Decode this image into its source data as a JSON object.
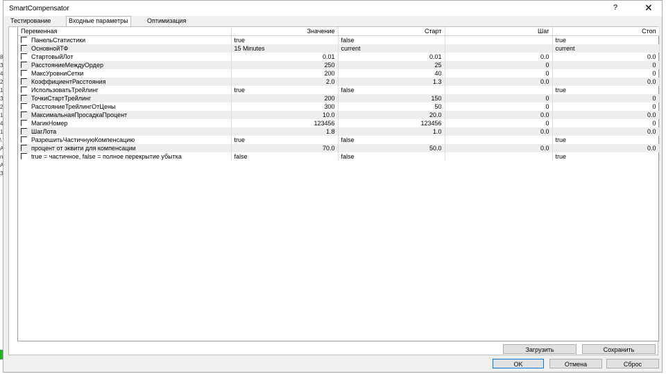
{
  "window": {
    "title": "SmartCompensator",
    "help_label": "?",
    "close_label": "✕"
  },
  "background_glyphs": [
    "8",
    "3",
    "4",
    "2",
    "1",
    "3",
    "2",
    "1",
    "4",
    "1",
    "\\",
    "A",
    "n",
    "A",
    "3"
  ],
  "tabs": [
    "Тестирование",
    "Входные параметры",
    "Оптимизация"
  ],
  "active_tab": 1,
  "columns": [
    "Переменная",
    "Значение",
    "Старт",
    "Шаг",
    "Стоп"
  ],
  "rows": [
    {
      "name": "ПанельСтатистики",
      "value": "true",
      "start": "false",
      "step": "",
      "stop": "true"
    },
    {
      "name": "ОсновнойТФ",
      "value": "15 Minutes",
      "start": "current",
      "step": "",
      "stop": "current"
    },
    {
      "name": "СтартовыйЛот",
      "value": "0.01",
      "start": "0.01",
      "step": "0.0",
      "stop": "0.0"
    },
    {
      "name": "РасстояниеМеждуОрдер",
      "value": "250",
      "start": "25",
      "step": "0",
      "stop": "0"
    },
    {
      "name": "МаксУровниСетки",
      "value": "200",
      "start": "40",
      "step": "0",
      "stop": "0"
    },
    {
      "name": "КоэффициентРасстояния",
      "value": "2.0",
      "start": "1.3",
      "step": "0.0",
      "stop": "0.0"
    },
    {
      "name": "ИспользоватьТрейлинг",
      "value": "true",
      "start": "false",
      "step": "",
      "stop": "true"
    },
    {
      "name": "ТочкиСтартТрейлинг",
      "value": "200",
      "start": "150",
      "step": "0",
      "stop": "0"
    },
    {
      "name": "РасстояниеТрейлингОтЦены",
      "value": "300",
      "start": "50",
      "step": "0",
      "stop": "0"
    },
    {
      "name": "МаксимальнаяПросадкаПроцент",
      "value": "10.0",
      "start": "20.0",
      "step": "0.0",
      "stop": "0.0"
    },
    {
      "name": "МагикНомер",
      "value": "123456",
      "start": "123456",
      "step": "0",
      "stop": "0"
    },
    {
      "name": "ШагЛота",
      "value": "1.8",
      "start": "1.0",
      "step": "0.0",
      "stop": "0.0"
    },
    {
      "name": "РазрешитьЧастичнуюКомпенсацию",
      "value": "true",
      "start": "false",
      "step": "",
      "stop": "true"
    },
    {
      "name": "процент от эквити для компенсации",
      "value": "70.0",
      "start": "50.0",
      "step": "0.0",
      "stop": "0.0"
    },
    {
      "name": "true = частичное, false = полное перекрытие убытка",
      "value": "false",
      "start": "false",
      "step": "",
      "stop": "true"
    }
  ],
  "buttons": {
    "load": "Загрузить",
    "save": "Сохранить",
    "ok": "OK",
    "cancel": "Отмена",
    "reset": "Сброс"
  }
}
